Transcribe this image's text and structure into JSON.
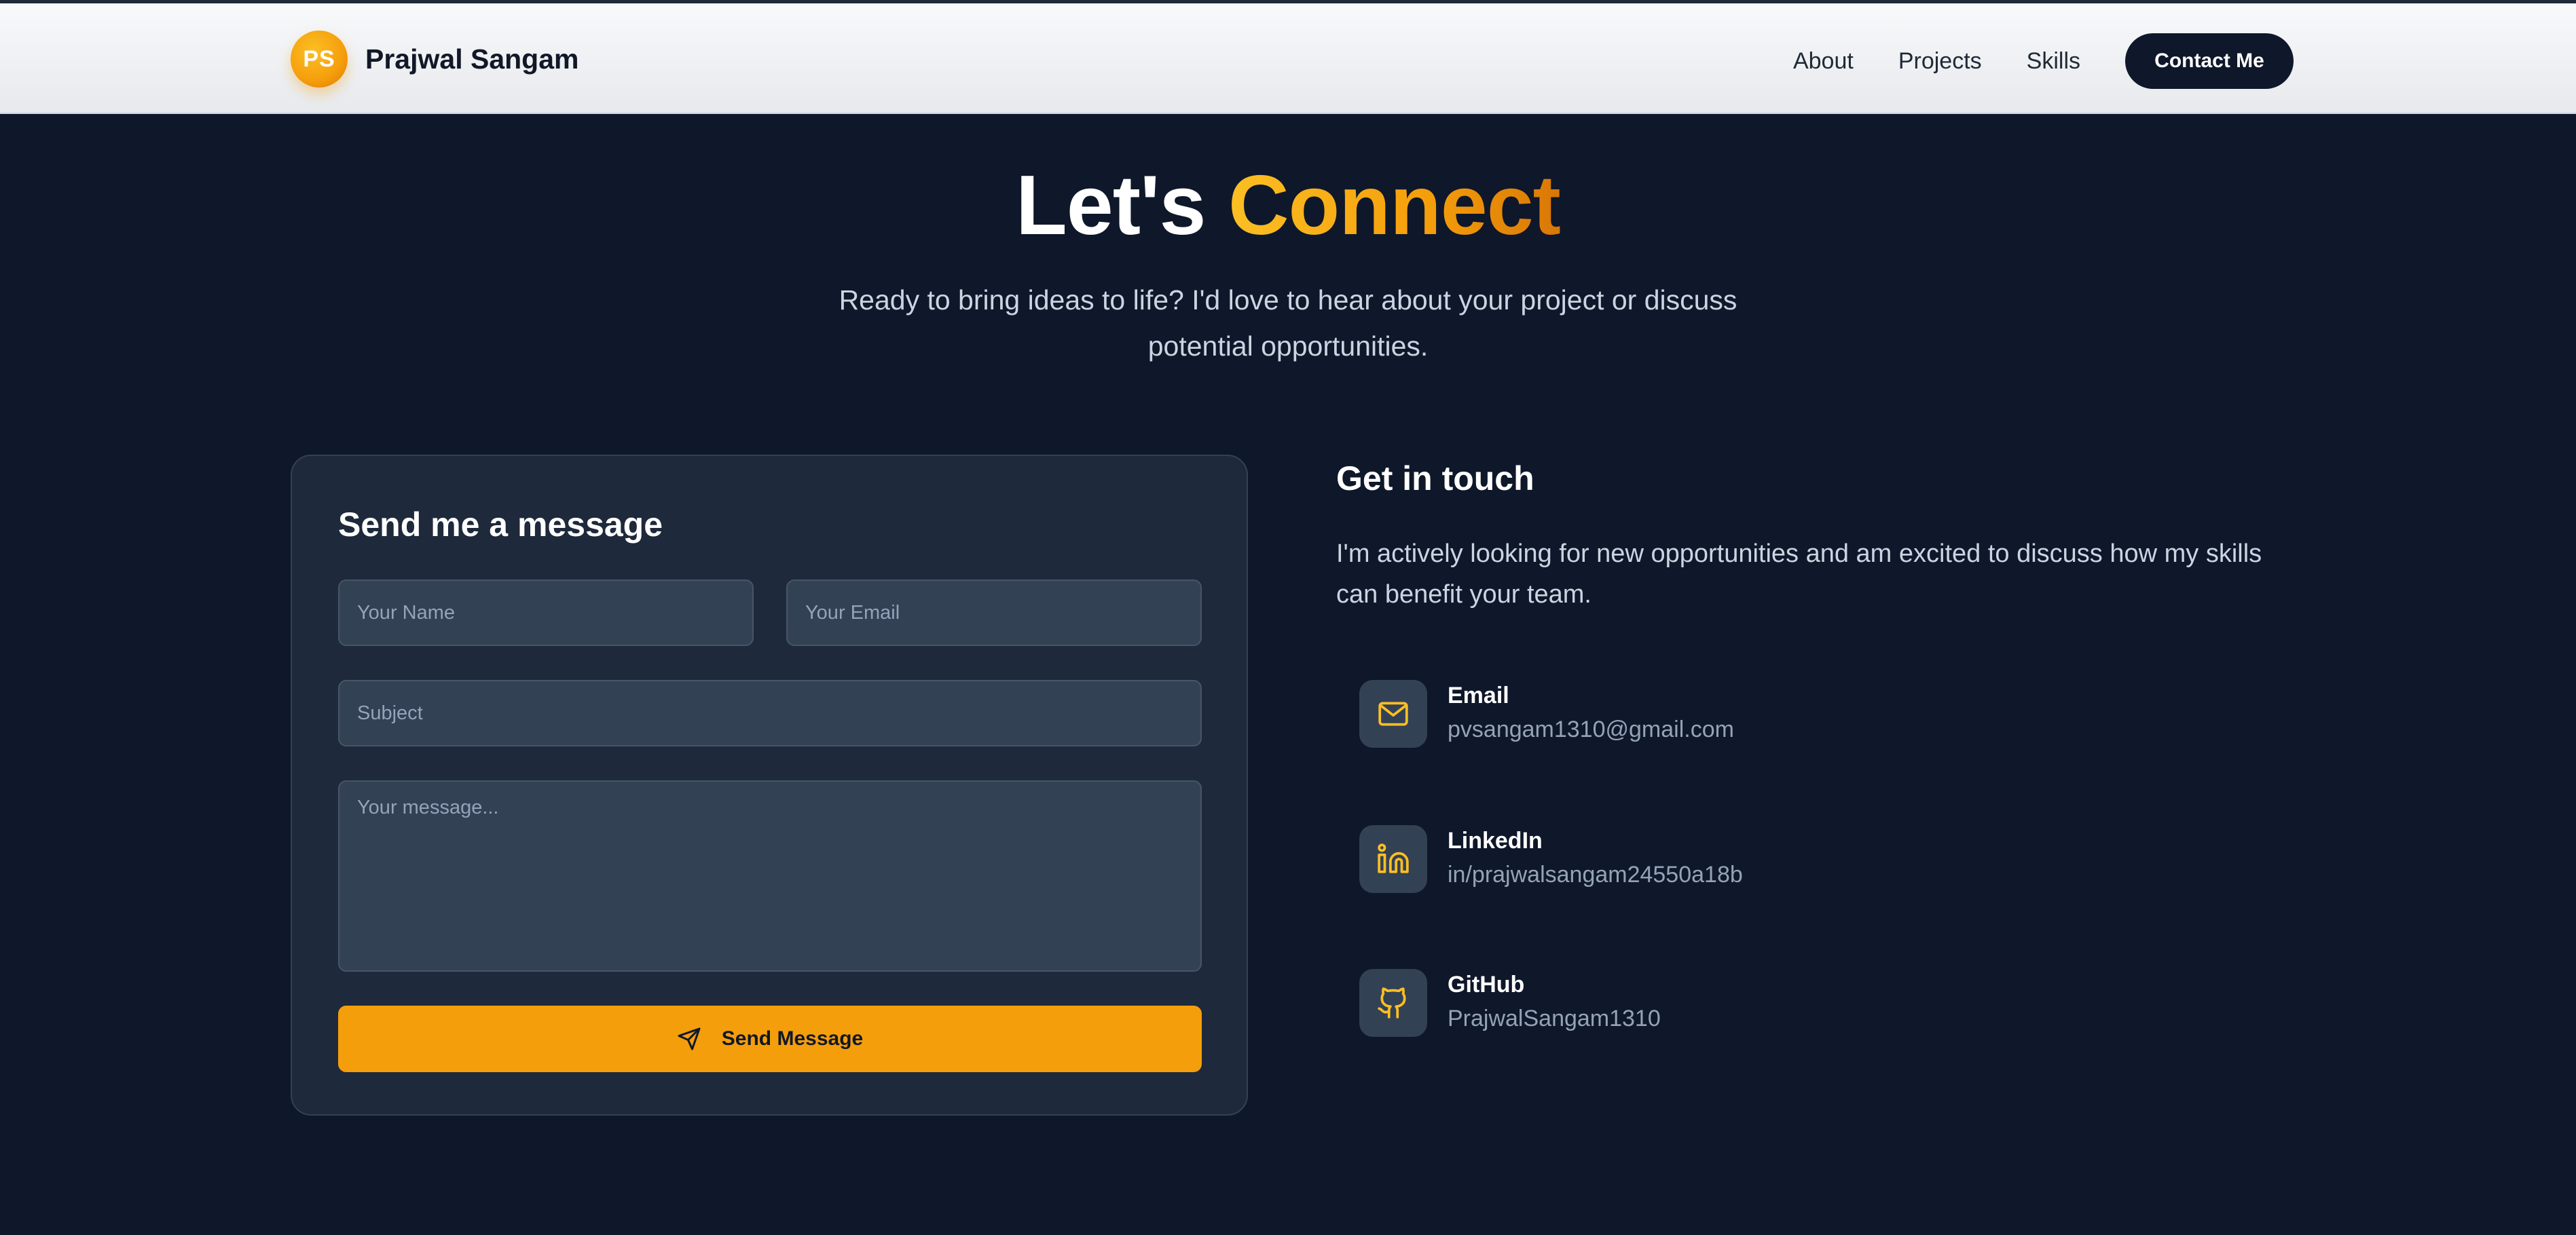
{
  "nav": {
    "logo_initials": "PS",
    "brand_name": "Prajwal Sangam",
    "links": [
      "About",
      "Projects",
      "Skills"
    ],
    "cta_label": "Contact Me"
  },
  "hero": {
    "title_plain": "Let's",
    "title_accent": "Connect",
    "subtitle": "Ready to bring ideas to life? I'd love to hear about your project or discuss potential opportunities."
  },
  "form": {
    "title": "Send me a message",
    "name_placeholder": "Your Name",
    "email_placeholder": "Your Email",
    "subject_placeholder": "Subject",
    "message_placeholder": "Your message...",
    "submit_label": "Send Message"
  },
  "contact": {
    "title": "Get in touch",
    "intro": "I'm actively looking for new opportunities and am excited to discuss how my skills can benefit your team.",
    "items": [
      {
        "label": "Email",
        "value": "pvsangam1310@gmail.com",
        "icon": "mail-icon"
      },
      {
        "label": "LinkedIn",
        "value": "in/prajwalsangam24550a18b",
        "icon": "linkedin-icon"
      },
      {
        "label": "GitHub",
        "value": "PrajwalSangam1310",
        "icon": "github-icon"
      }
    ]
  },
  "colors": {
    "background": "#0f172a",
    "card": "#1e293b",
    "input": "#334155",
    "accent": "#f59e0b",
    "nav_background": "#f1f2f4"
  }
}
